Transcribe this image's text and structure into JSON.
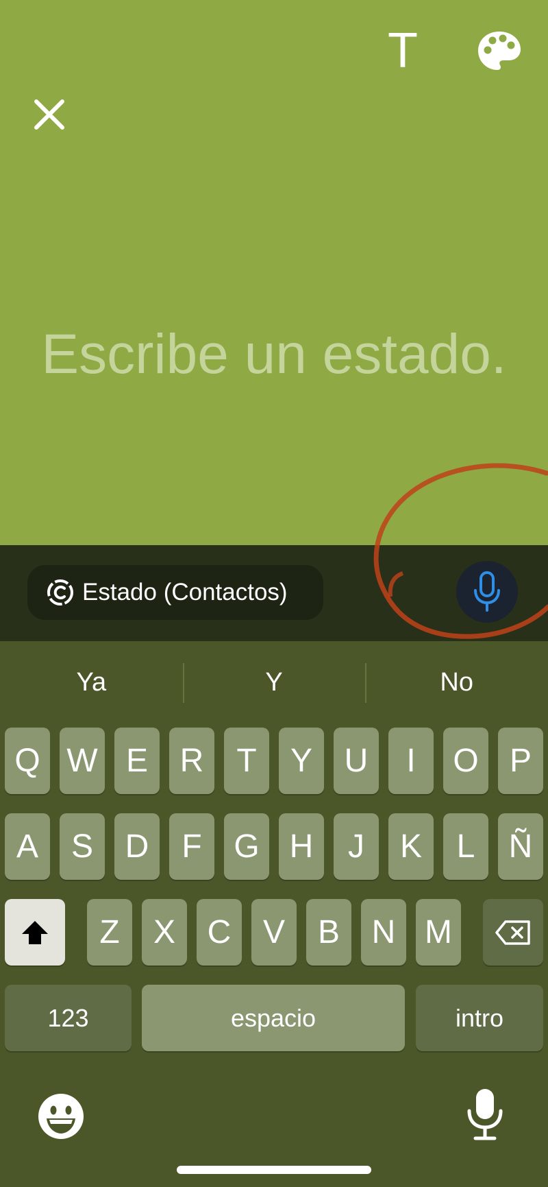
{
  "toolbar": {
    "close_icon": "close-icon",
    "text_tool_label": "T",
    "palette_icon": "palette-icon"
  },
  "editor": {
    "placeholder": "Escribe un estado."
  },
  "composer": {
    "audience_label": "Estado (Contactos)",
    "audience_icon": "status-ring-icon",
    "mic_icon": "microphone-icon",
    "accent_color": "#2f8fe6"
  },
  "keyboard": {
    "suggestions": [
      "Ya",
      "Y",
      "No"
    ],
    "row1": [
      "Q",
      "W",
      "E",
      "R",
      "T",
      "Y",
      "U",
      "I",
      "O",
      "P"
    ],
    "row2": [
      "A",
      "S",
      "D",
      "F",
      "G",
      "H",
      "J",
      "K",
      "L",
      "Ñ"
    ],
    "row3": [
      "Z",
      "X",
      "C",
      "V",
      "B",
      "N",
      "M"
    ],
    "numbers_label": "123",
    "space_label": "espacio",
    "return_label": "intro",
    "emoji_icon": "emoji-icon",
    "dictation_icon": "dictation-mic-icon",
    "shift_icon": "shift-icon",
    "delete_icon": "backspace-icon"
  },
  "colors": {
    "background": "#8fa944",
    "annotation": "#c0421a"
  }
}
